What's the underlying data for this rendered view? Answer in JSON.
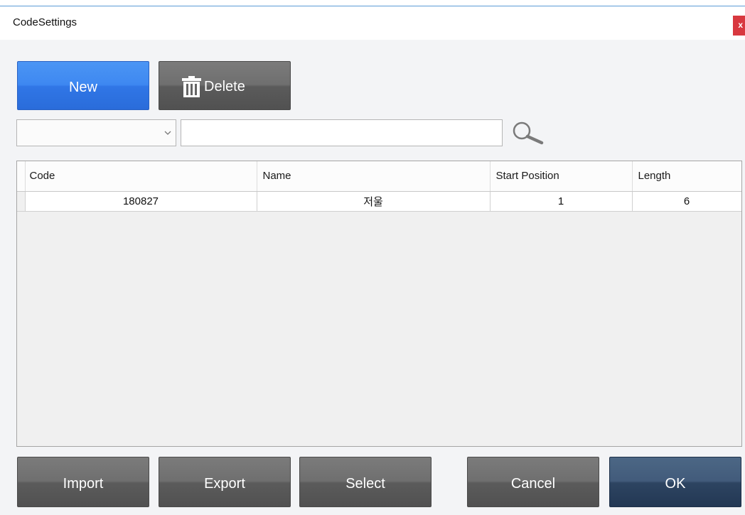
{
  "window": {
    "title": "CodeSettings",
    "close_label": "x"
  },
  "toolbar": {
    "new_label": "New",
    "delete_label": "Delete"
  },
  "table": {
    "columns": [
      "Code",
      "Name",
      "Start Position",
      "Length"
    ],
    "rows": [
      {
        "code": "180827",
        "name": "저울",
        "start_position": "1",
        "length": "6"
      }
    ]
  },
  "footer": {
    "import_label": "Import",
    "export_label": "Export",
    "select_label": "Select",
    "cancel_label": "Cancel",
    "ok_label": "OK"
  },
  "icons": {
    "delete": "trash-icon",
    "search": "search-icon",
    "filter_dropdown": "chevron-down-icon",
    "close": "close-icon"
  },
  "colors": {
    "primary_button": "#3e88f1",
    "neutral_button": "#636363",
    "confirm_button": "#344d6b",
    "close_button": "#d8383f",
    "window_background": "#f3f4f6",
    "title_bar_accent": "#5b9bd5"
  }
}
